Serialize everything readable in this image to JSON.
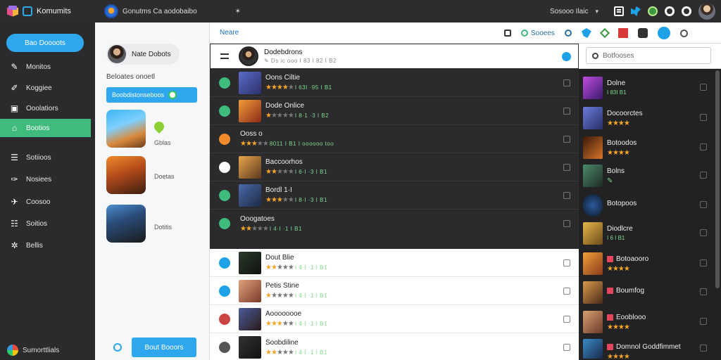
{
  "topbar": {
    "brand": "Komumits",
    "title": "Gonutms Ca aodobaibo",
    "star": "✶",
    "search_label": "Sosooo Ilaic",
    "caret": "▾"
  },
  "sidebar": {
    "primary_button": "Bao Doooots",
    "items": [
      {
        "label": "Monitos",
        "icon": "✎"
      },
      {
        "label": "Koggiee",
        "icon": "✐"
      },
      {
        "label": "Ooolatiors",
        "icon": "▣"
      },
      {
        "label": "Bootios",
        "icon": "⌂"
      },
      {
        "label": "Sotiioos",
        "icon": "☰"
      },
      {
        "label": "Nosiees",
        "icon": "✑"
      },
      {
        "label": "Coosoo",
        "icon": "✈"
      },
      {
        "label": "Soitios",
        "icon": "☷"
      },
      {
        "label": "Bellis",
        "icon": "✲"
      }
    ],
    "footer": "Sumorttlials"
  },
  "col2": {
    "user_name": "Nate Dobots",
    "section_label": "Beloates onoetl",
    "action_button": "Boobdistonseboos",
    "cards": [
      {
        "label": "Gblas"
      },
      {
        "label": "Doetas"
      },
      {
        "label": "Dotitis"
      }
    ],
    "bottom_button": "Bout Booors"
  },
  "main": {
    "header_label": "Neare",
    "search_label": "Sooees",
    "chat_title": "Dodebdrons",
    "chat_sub": "✎ Ds ic ooo I 83 I 82 I B2",
    "dark_rows": [
      {
        "name": "Oons Ciltie",
        "meta": "I 63I ·95 I B1",
        "stars_on": 4
      },
      {
        "name": "Dode Onlice",
        "meta": "I 8·1 ·3 I B2",
        "stars_on": 1
      },
      {
        "name": "Ooss o",
        "meta": "8011 I B1 I oooooo too",
        "stars_on": 3
      },
      {
        "name": "Baccoorhos",
        "meta": "I 6·I ·3 I B1",
        "stars_on": 2
      },
      {
        "name": "Bordl 1·I",
        "meta": "I 8·I ·3 I B1",
        "stars_on": 3
      },
      {
        "name": "Ooogatoes",
        "meta": "I 4·I ·1 I B1",
        "stars_on": 2
      }
    ],
    "light_rows": [
      {
        "name": "Dout Blie",
        "meta": "I 4·I ·1 I B1",
        "stars_on": 2
      },
      {
        "name": "Petis Stine",
        "meta": "I 4·I ·1 I B1",
        "stars_on": 1
      },
      {
        "name": "Aoooooooe",
        "meta": "I 4·I ·1 I B1",
        "stars_on": 3
      },
      {
        "name": "Soobdiline",
        "meta": "I 4·I ·1 I B1",
        "stars_on": 2
      }
    ]
  },
  "right": {
    "search_placeholder": "Botfooses",
    "items": [
      {
        "name": "Dolne",
        "meta": "I 83I B1"
      },
      {
        "name": "Docoorctes",
        "meta": "★★★★"
      },
      {
        "name": "Botoodos",
        "meta": "★★★★"
      },
      {
        "name": "Bolns",
        "meta": "✎"
      },
      {
        "name": "Botopoos",
        "meta": ""
      },
      {
        "name": "Diodlcre",
        "meta": "I 6 I B1"
      },
      {
        "name": "Botoaooro",
        "meta": "★★★★"
      },
      {
        "name": "Boumfog",
        "meta": ""
      },
      {
        "name": "Eooblooo",
        "meta": "★★★★"
      },
      {
        "name": "Domnol Goddfimmet",
        "meta": "★★★★"
      }
    ]
  },
  "colors": {
    "accent_blue": "#2ea7ee",
    "accent_green": "#3fbb7d",
    "sidebar_bg": "#2b2b2d",
    "dark_list_bg": "#2b2b2d",
    "star": "#f3a623"
  }
}
